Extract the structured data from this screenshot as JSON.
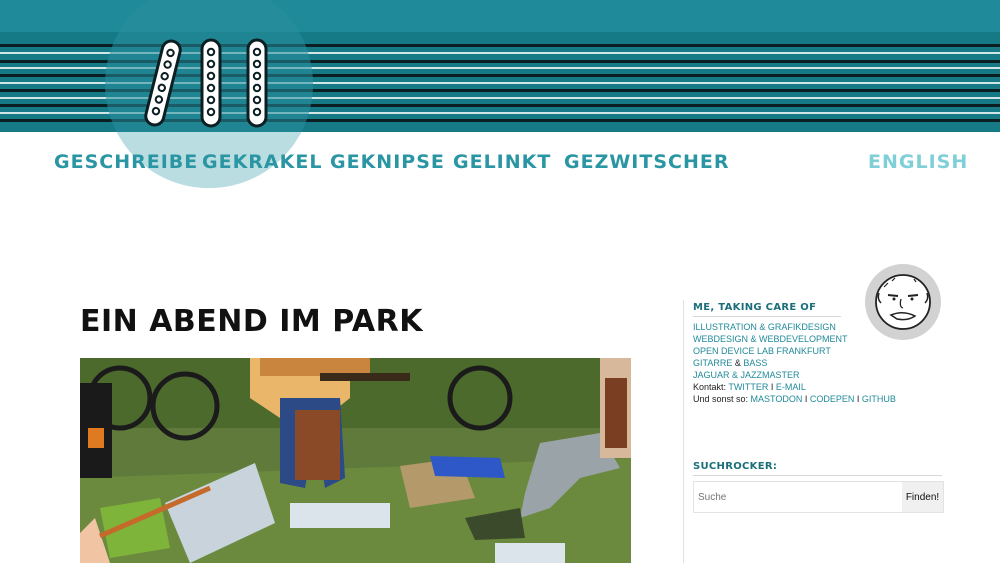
{
  "nav": {
    "items": [
      "GESCHREIBE",
      "GEKRAKEL",
      "GEKNIPSE",
      "GELINKT",
      "GEZWITSCHER"
    ],
    "language": "ENGLISH"
  },
  "article": {
    "title": "EIN ABEND IM PARK"
  },
  "sidebar": {
    "about": {
      "heading": "ME, TAKING CARE OF",
      "links": [
        "ILLUSTRATION & GRAFIKDESIGN",
        "WEBDESIGN & WEBDEVELOPMENT",
        "OPEN DEVICE LAB FRANKFURT"
      ],
      "guitar": "GITARRE",
      "and1": " & ",
      "bass": "BASS",
      "jaguar": "JAGUAR & JAZZMASTER",
      "contact_label": "Kontakt: ",
      "twitter": "TWITTER",
      "sep1": " I ",
      "email": "E-MAIL",
      "else_label": "Und sonst so: ",
      "mastodon": "MASTODON",
      "sep2": " I ",
      "codepen": "CODEPEN",
      "sep3": " I ",
      "github": "GITHUB"
    },
    "search": {
      "heading": "SUCHROCKER:",
      "placeholder": "Suche",
      "button": "Finden!"
    }
  },
  "colors": {
    "teal": "#1f8a99",
    "teal_dark": "#167a86",
    "nav_text": "#2a96a4",
    "nav_lang": "#7fcfd8"
  }
}
